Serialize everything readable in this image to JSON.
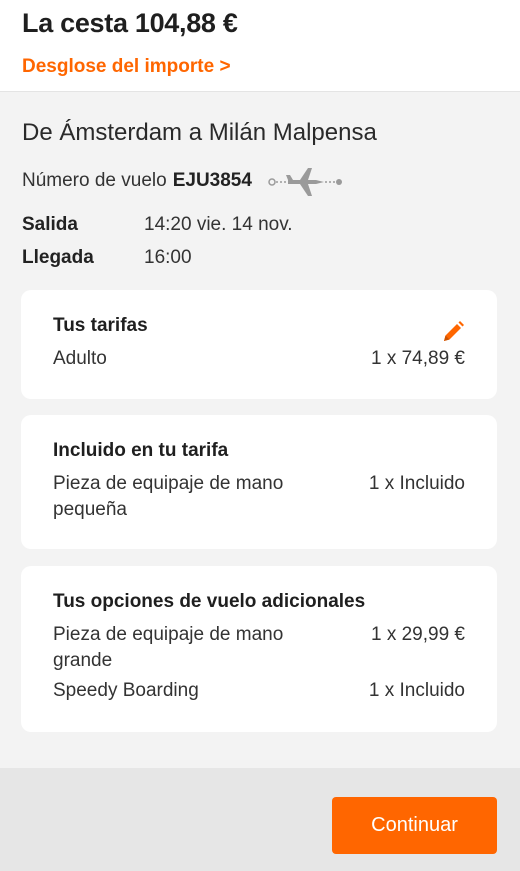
{
  "header": {
    "basket_total": "La cesta 104,88 €",
    "breakdown_link": "Desglose del importe >"
  },
  "flight": {
    "route": "De Ámsterdam a Milán Malpensa",
    "flight_number_label": "Número de vuelo",
    "flight_number": "EJU3854",
    "departure_label": "Salida",
    "departure_value": "14:20 vie. 14 nov.",
    "arrival_label": "Llegada",
    "arrival_value": "16:00",
    "plane_icon": "plane-icon"
  },
  "cards": {
    "fares": {
      "title": "Tus tarifas",
      "edit_icon": "pencil-icon",
      "items": [
        {
          "name": "Adulto",
          "qty": "1 x 74,89 €"
        }
      ]
    },
    "included": {
      "title": "Incluido en tu tarifa",
      "items": [
        {
          "name": "Pieza de equipaje de mano pequeña",
          "qty": "1 x Incluido"
        }
      ]
    },
    "extras": {
      "title": "Tus opciones de vuelo adicionales",
      "items": [
        {
          "name": "Pieza de equipaje de mano grande",
          "qty": "1 x 29,99 €"
        },
        {
          "name": "Speedy Boarding",
          "qty": "1 x Incluido"
        }
      ]
    }
  },
  "footer": {
    "continue_label": "Continuar"
  },
  "colors": {
    "accent": "#ff6600",
    "page_bg": "#f3f3f3",
    "footer_bg": "#e6e6e6"
  }
}
